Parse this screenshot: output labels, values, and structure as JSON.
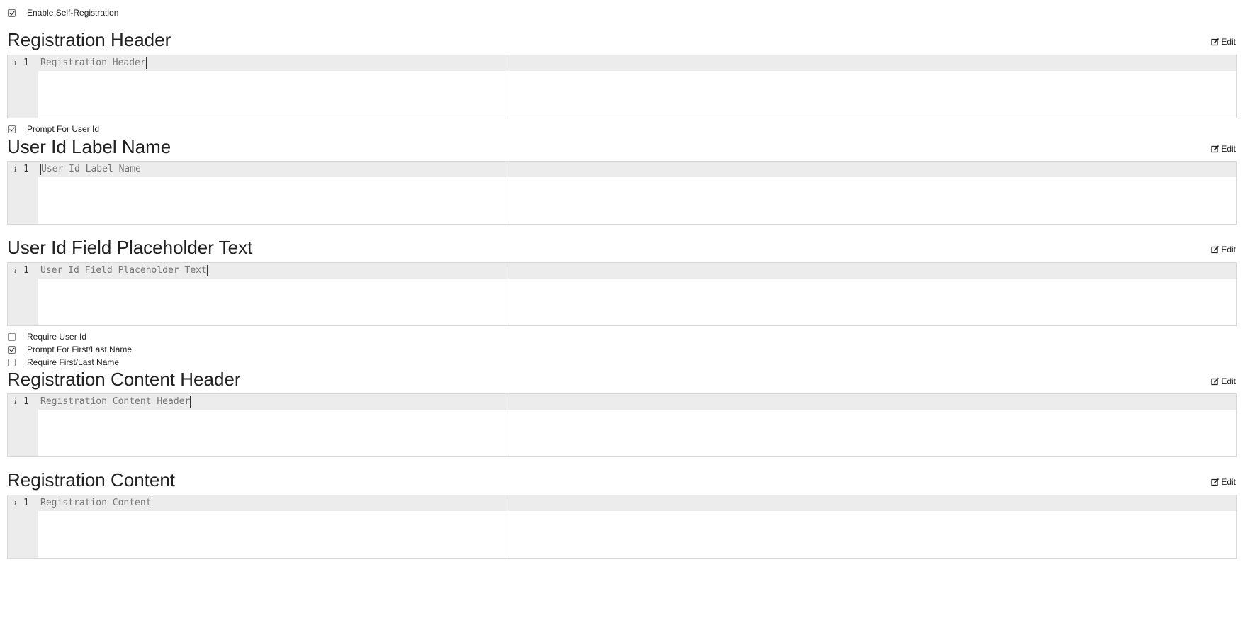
{
  "checkboxes": {
    "enable_self_registration": {
      "label": "Enable Self-Registration",
      "checked": true
    },
    "prompt_for_user_id": {
      "label": "Prompt For User Id",
      "checked": true
    },
    "require_user_id": {
      "label": "Require User Id",
      "checked": false
    },
    "prompt_first_last": {
      "label": "Prompt For First/Last Name",
      "checked": true
    },
    "require_first_last": {
      "label": "Require First/Last Name",
      "checked": false
    }
  },
  "sections": [
    {
      "title": "Registration Header",
      "edit_label": "Edit",
      "line_info": "i",
      "line_number": "1",
      "content": "Registration Header",
      "caret": "end"
    },
    {
      "title": "User Id Label Name",
      "edit_label": "Edit",
      "line_info": "i",
      "line_number": "1",
      "content": "User Id Label Name",
      "caret": "start"
    },
    {
      "title": "User Id Field Placeholder Text",
      "edit_label": "Edit",
      "line_info": "i",
      "line_number": "1",
      "content": "User Id Field Placeholder Text",
      "caret": "end"
    },
    {
      "title": "Registration Content Header",
      "edit_label": "Edit",
      "line_info": "i",
      "line_number": "1",
      "content": "Registration Content Header",
      "caret": "end"
    },
    {
      "title": "Registration Content",
      "edit_label": "Edit",
      "line_info": "i",
      "line_number": "1",
      "content": "Registration Content",
      "caret": "end"
    }
  ],
  "icons": {
    "edit": "edit-square-icon",
    "info": "info-icon"
  }
}
